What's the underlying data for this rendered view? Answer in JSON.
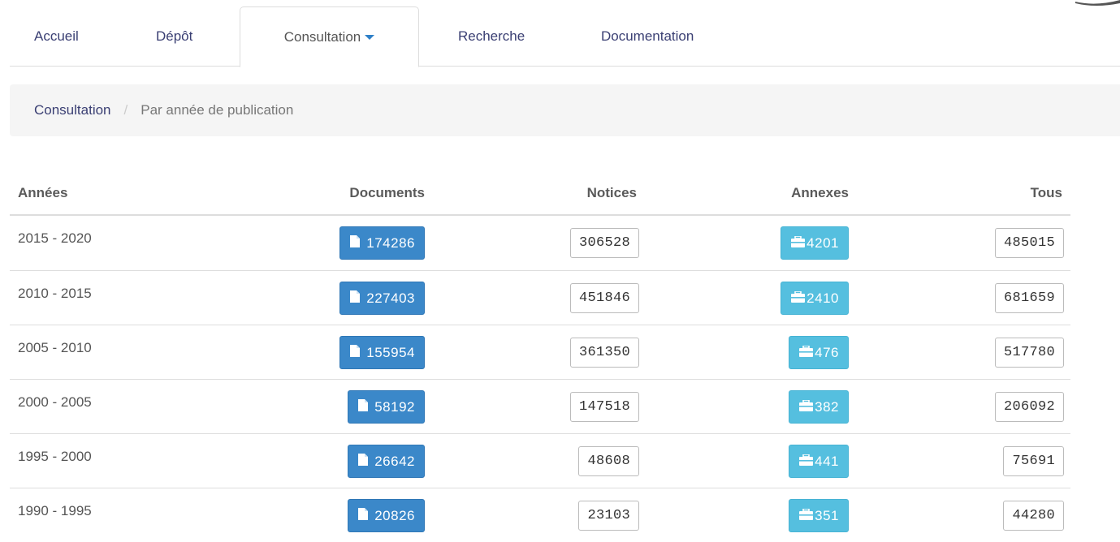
{
  "nav": {
    "tabs": [
      {
        "label": "Accueil"
      },
      {
        "label": "Dépôt"
      },
      {
        "label": "Consultation",
        "active": true,
        "dropdown": true
      },
      {
        "label": "Recherche"
      },
      {
        "label": "Documentation"
      }
    ]
  },
  "breadcrumb": {
    "root": "Consultation",
    "separator": "/",
    "current": "Par année de publication"
  },
  "table": {
    "headers": {
      "years": "Années",
      "documents": "Documents",
      "notices": "Notices",
      "annexes": "Annexes",
      "tous": "Tous"
    },
    "rows": [
      {
        "years": "2015 - 2020",
        "documents": "174286",
        "notices": "306528",
        "annexes": "4201",
        "tous": "485015"
      },
      {
        "years": "2010 - 2015",
        "documents": "227403",
        "notices": "451846",
        "annexes": "2410",
        "tous": "681659"
      },
      {
        "years": "2005 - 2010",
        "documents": "155954",
        "notices": "361350",
        "annexes": "476",
        "tous": "517780"
      },
      {
        "years": "2000 - 2005",
        "documents": "58192",
        "notices": "147518",
        "annexes": "382",
        "tous": "206092"
      },
      {
        "years": "1995 - 2000",
        "documents": "26642",
        "notices": "48608",
        "annexes": "441",
        "tous": "75691"
      },
      {
        "years": "1990 - 1995",
        "documents": "20826",
        "notices": "23103",
        "annexes": "351",
        "tous": "44280"
      }
    ]
  },
  "icons": {
    "documents": "file-icon",
    "annexes": "briefcase-icon"
  },
  "colors": {
    "primary": "#3b88c9",
    "info": "#55bfdf",
    "link": "#3a3f73"
  }
}
